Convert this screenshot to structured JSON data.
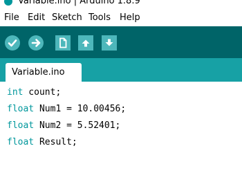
{
  "window": {
    "title": "Variable.ino | Arduino 1.8.9"
  },
  "menu": [
    "File",
    "Edit",
    "Sketch",
    "Tools",
    "Help"
  ],
  "toolbar": {
    "buttons": [
      {
        "name": "verify",
        "icon": "check-icon"
      },
      {
        "name": "upload",
        "icon": "arrow-right-icon"
      },
      {
        "name": "new",
        "icon": "new-file-icon"
      },
      {
        "name": "open",
        "icon": "arrow-up-icon"
      },
      {
        "name": "save",
        "icon": "arrow-down-icon"
      }
    ]
  },
  "tabs": [
    {
      "label": "Variable.ino"
    }
  ],
  "code": [
    {
      "type": "int",
      "rest": " count;"
    },
    {
      "type": "float",
      "rest": " Num1 = 10.00456;"
    },
    {
      "type": "float",
      "rest": " Num2 = 5.52401;"
    },
    {
      "type": "float",
      "rest": " Result;"
    }
  ],
  "colors": {
    "toolbar": "#006468",
    "tab_strip": "#17a1a5",
    "button": "#4db7bb",
    "keyword": "#00979c"
  }
}
